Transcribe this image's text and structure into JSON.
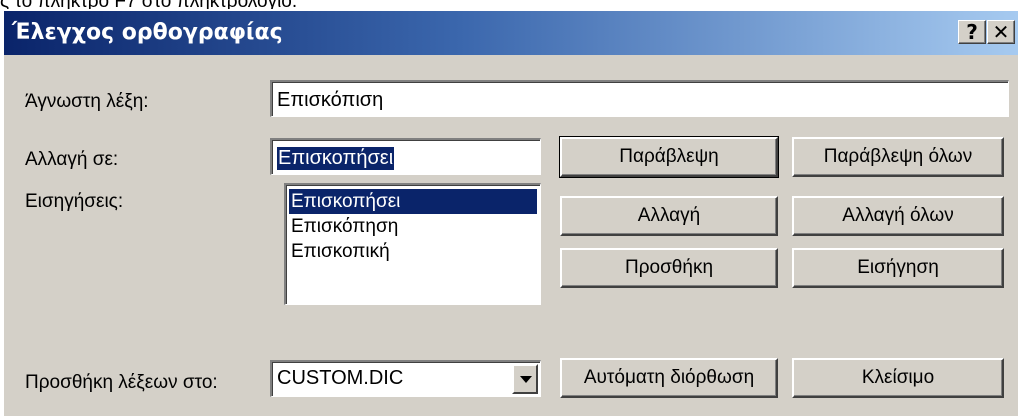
{
  "top_text": "ς το πλήκτρο F7 στο πληκτρολόγιο.",
  "dialog": {
    "title": "Έλεγχος ορθογραφίας",
    "help_button": "?",
    "close_button": "✕"
  },
  "labels": {
    "unknown_word": "Άγνωστη λέξη:",
    "change_to": "Αλλαγή σε:",
    "suggestions": "Εισηγήσεις:",
    "add_words_to": "Προσθήκη λέξεων στο:"
  },
  "fields": {
    "unknown_word_value": "Επισκόπιση",
    "change_to_value": "Επισκοπήσει",
    "dictionary_value": "CUSTOM.DIC"
  },
  "suggestions": [
    "Επισκοπήσει",
    "Επισκόπηση",
    "Επισκοπική"
  ],
  "selected_suggestion_index": 0,
  "buttons": {
    "ignore": "Παράβλεψη",
    "ignore_all": "Παράβλεψη όλων",
    "change": "Αλλαγή",
    "change_all": "Αλλαγή όλων",
    "add": "Προσθήκη",
    "suggest": "Εισήγηση",
    "autocorrect": "Αυτόματη διόρθωση",
    "close": "Κλείσιμο"
  },
  "colors": {
    "title_gradient_start": "#0a246a",
    "title_gradient_end": "#a6caf0",
    "dialog_face": "#d4d0c8",
    "selection": "#0a246a"
  }
}
